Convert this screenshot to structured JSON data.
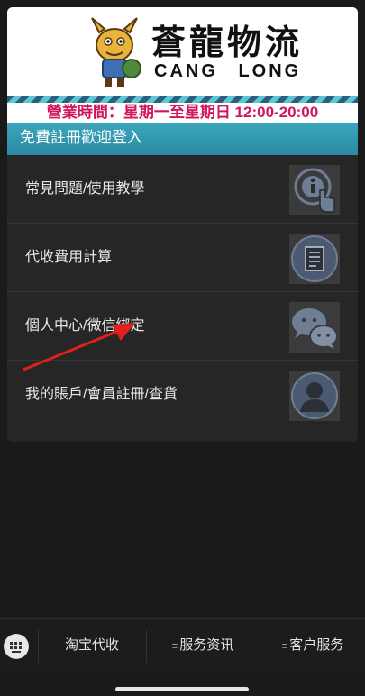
{
  "header": {
    "brand_cn": "蒼龍物流",
    "brand_en": "CANG LONG",
    "hours": "營業時間：星期一至星期日 12:00-20:00",
    "welcome": "免費註冊歡迎登入"
  },
  "menu": {
    "items": [
      {
        "label": "常見問題/使用教學",
        "icon": "info-touch-icon"
      },
      {
        "label": "代收費用計算",
        "icon": "document-icon"
      },
      {
        "label": "個人中心/微信綁定",
        "icon": "wechat-icon"
      },
      {
        "label": "我的賬戶/會員註冊/查貨",
        "icon": "user-icon"
      }
    ]
  },
  "bottom_bar": {
    "tabs": [
      {
        "label": "淘宝代收"
      },
      {
        "label": "服务资讯"
      },
      {
        "label": "客户服务"
      }
    ]
  },
  "colors": {
    "accent": "#4ab8cc",
    "hours_text": "#d4145a",
    "background": "#1a1a1a",
    "card": "#262626"
  }
}
